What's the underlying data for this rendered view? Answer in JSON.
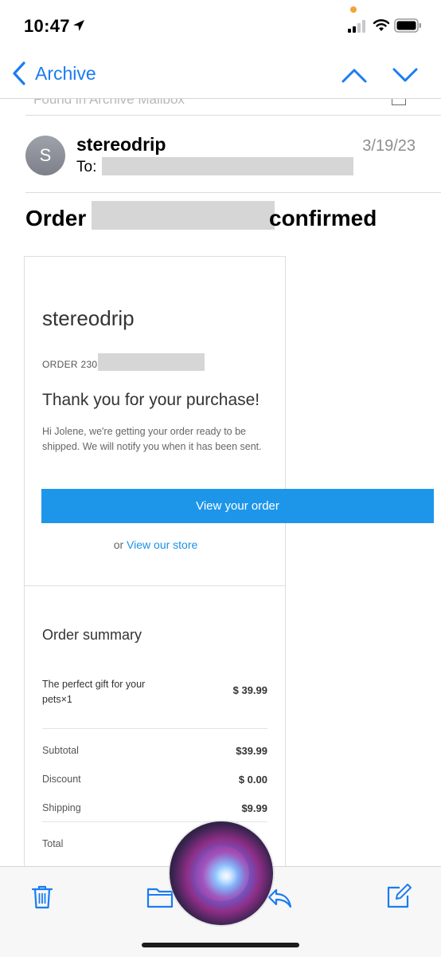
{
  "status_bar": {
    "time": "10:47",
    "location_icon": "location-arrow-icon",
    "signal_icon": "cell-signal-icon",
    "wifi_icon": "wifi-icon",
    "battery_icon": "battery-icon",
    "privacy_dot_color": "#f2a33a"
  },
  "nav": {
    "back_label": "Archive",
    "back_icon": "chevron-left-icon",
    "prev_icon": "chevron-up-icon",
    "next_icon": "chevron-down-icon",
    "accent_color": "#1a7cf2"
  },
  "message": {
    "found_in": "Found in Archive Mailbox",
    "avatar_initial": "S",
    "sender": "stereodrip",
    "date": "3/19/23",
    "to_label": "To:",
    "subject_start": "Order",
    "subject_end": "confirmed"
  },
  "email_body": {
    "store_name": "stereodrip",
    "order_label": "ORDER 230",
    "thanks": "Thank you for your purchase!",
    "notice": "Hi Jolene, we're getting your order ready to be shipped. We will notify you when it has been sent.",
    "view_order_button": "View your order",
    "or_text": "or",
    "view_store_link": "View our store",
    "button_color": "#1d96ea",
    "summary": {
      "title": "Order summary",
      "item_name": "The perfect gift for your pets×1",
      "item_price": "$ 39.99",
      "rows": [
        {
          "label": "Subtotal",
          "value": "$39.99"
        },
        {
          "label": "Discount",
          "value": "$ 0.00"
        },
        {
          "label": "Shipping",
          "value": "$9.99"
        },
        {
          "label": "Total",
          "value": ""
        }
      ]
    }
  },
  "toolbar": {
    "icons": [
      "trash-icon",
      "folder-icon",
      "reply-icon",
      "compose-icon"
    ]
  }
}
